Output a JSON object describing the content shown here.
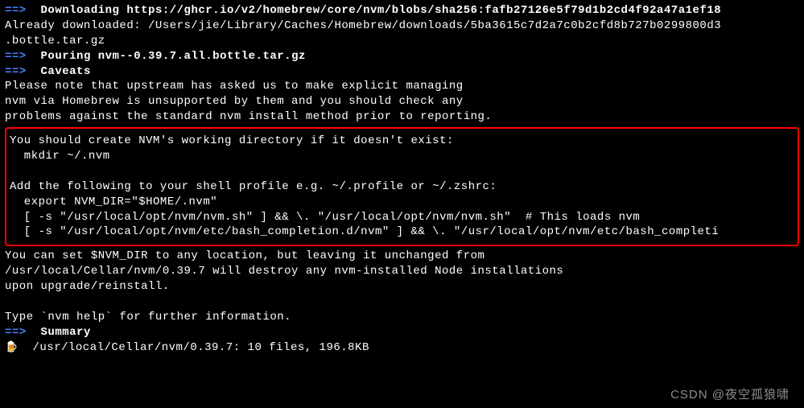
{
  "arrow": "==>",
  "lines": {
    "downloading": "Downloading https://ghcr.io/v2/homebrew/core/nvm/blobs/sha256:fafb27126e5f79d1b2cd4f92a47a1ef18",
    "already": "Already downloaded: /Users/jie/Library/Caches/Homebrew/downloads/5ba3615c7d2a7c0b2cfd8b727b0299800d3",
    "bottle_tar": ".bottle.tar.gz",
    "pouring": "Pouring nvm--0.39.7.all.bottle.tar.gz",
    "caveats": "Caveats",
    "note1": "Please note that upstream has asked us to make explicit managing",
    "note2": "nvm via Homebrew is unsupported by them and you should check any",
    "note3": "problems against the standard nvm install method prior to reporting.",
    "box1": "You should create NVM's working directory if it doesn't exist:",
    "box2": "  mkdir ~/.nvm",
    "box3": "Add the following to your shell profile e.g. ~/.profile or ~/.zshrc:",
    "box4": "  export NVM_DIR=\"$HOME/.nvm\"",
    "box5": "  [ -s \"/usr/local/opt/nvm/nvm.sh\" ] && \\. \"/usr/local/opt/nvm/nvm.sh\"  # This loads nvm",
    "box6": "  [ -s \"/usr/local/opt/nvm/etc/bash_completion.d/nvm\" ] && \\. \"/usr/local/opt/nvm/etc/bash_completi",
    "after1": "You can set $NVM_DIR to any location, but leaving it unchanged from",
    "after2": "/usr/local/Cellar/nvm/0.39.7 will destroy any nvm-installed Node installations",
    "after3": "upon upgrade/reinstall.",
    "help": "Type `nvm help` for further information.",
    "summary": "Summary",
    "summary_line": "/usr/local/Cellar/nvm/0.39.7: 10 files, 196.8KB"
  },
  "beer_icon": "🍺",
  "watermark": "CSDN @夜空孤狼啸"
}
